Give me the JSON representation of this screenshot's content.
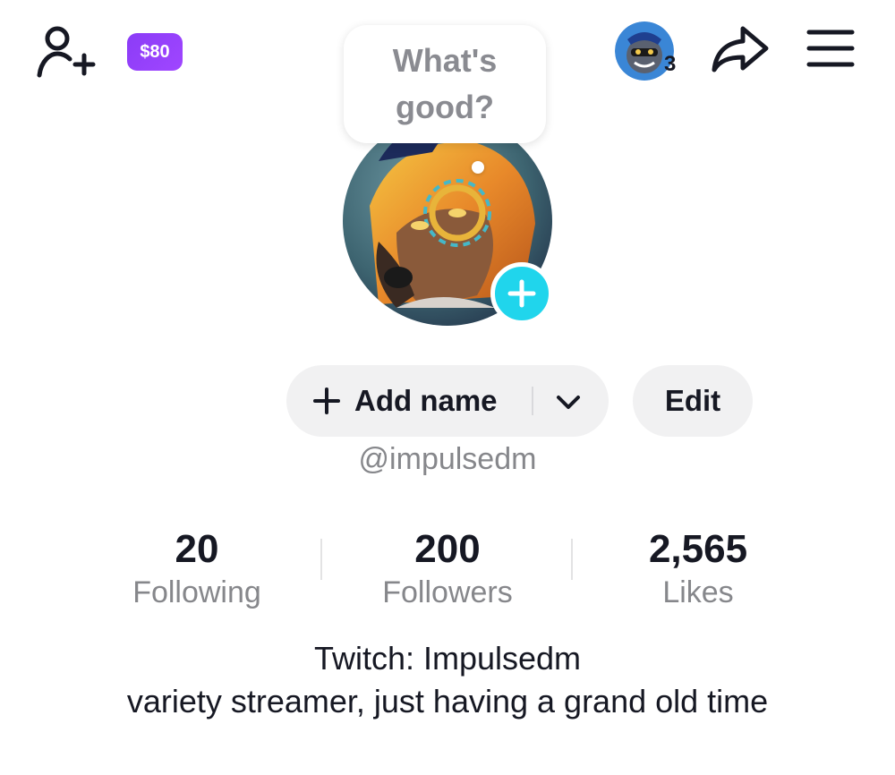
{
  "topbar": {
    "coins_label": "$80",
    "avatar_count": "3"
  },
  "bubble": {
    "text": "What's good?"
  },
  "profile": {
    "add_name_label": "Add name",
    "edit_label": "Edit",
    "username": "@impulsedm"
  },
  "stats": [
    {
      "value": "20",
      "label": "Following"
    },
    {
      "value": "200",
      "label": "Followers"
    },
    {
      "value": "2,565",
      "label": "Likes"
    }
  ],
  "bio": {
    "line1": "Twitch: Impulsedm",
    "line2": "variety streamer, just having a grand old time"
  },
  "colors": {
    "accent_cyan": "#20d5ec",
    "coin_purple": "#8b3cf7",
    "secondary_text": "#86878b",
    "button_bg": "#f1f1f2"
  }
}
